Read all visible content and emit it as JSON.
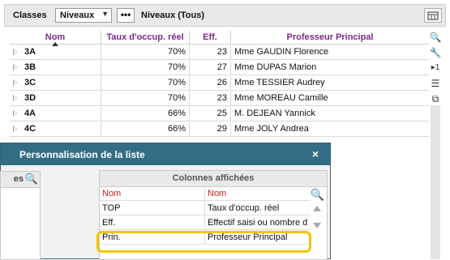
{
  "toolbar": {
    "classes_label": "Classes",
    "niveaux_select": "Niveaux",
    "more_label": "•••",
    "filter_label": "Niveaux (Tous)"
  },
  "grid": {
    "headers": [
      "Nom",
      "Taux d'occup. réel",
      "Eff.",
      "Professeur Principal"
    ],
    "rows": [
      [
        "3A",
        "70%",
        "23",
        "Mme GAUDIN Florence"
      ],
      [
        "3B",
        "70%",
        "27",
        "Mme DUPAS Marion"
      ],
      [
        "3C",
        "70%",
        "26",
        "Mme TESSIER Audrey"
      ],
      [
        "3D",
        "70%",
        "23",
        "Mme MOREAU Camille"
      ],
      [
        "4A",
        "66%",
        "25",
        "M. DEJEAN Yannick"
      ],
      [
        "4C",
        "66%",
        "29",
        "Mme JOLY Andrea"
      ]
    ]
  },
  "side_tools": [
    "search-icon",
    "wrench-icon",
    "play-one-icon",
    "list-icon",
    "copy-icon"
  ],
  "side_tool_glyphs": [
    "🔍",
    "🔧",
    "▸1",
    "☰",
    "⧉"
  ],
  "dialog": {
    "title": "Personnalisation de la liste",
    "close_label": "×",
    "left_panel_label": "es",
    "right_panel": {
      "header": "Colonnes affichées",
      "rows": [
        [
          "Nom",
          "Nom"
        ],
        [
          "TOP",
          "Taux d'occup. réel"
        ],
        [
          "Eff.",
          "Effectif saisi ou nombre d"
        ],
        [
          "Prin.",
          "Professeur Principal"
        ]
      ]
    }
  },
  "colors": {
    "header_text": "#7b2a8a",
    "dialog_title_bg": "#336d85",
    "highlight": "#f3c400",
    "red_text": "#c81e1e"
  }
}
